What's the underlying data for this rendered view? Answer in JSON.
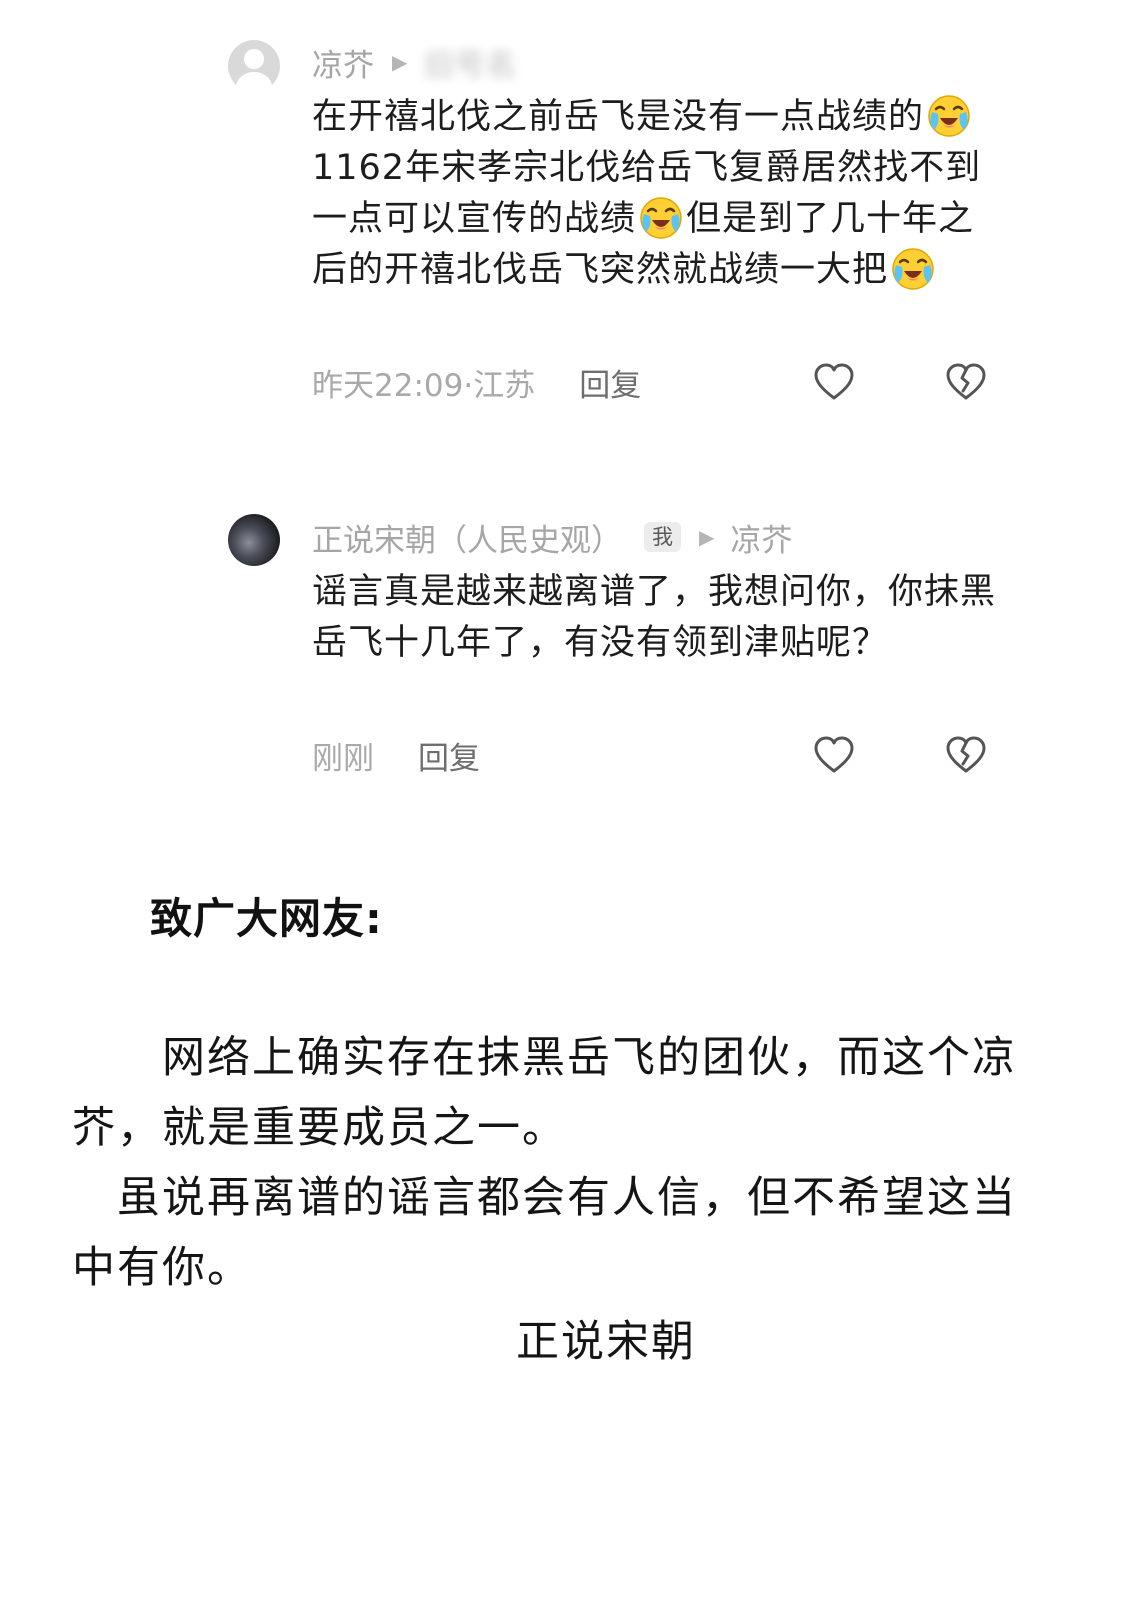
{
  "comment1": {
    "username": "凉芥",
    "reply_to": "旧号名",
    "text_segments": [
      {
        "type": "text",
        "value": "在开禧北伐之前岳飞是没有一点战绩的"
      },
      {
        "type": "emoji",
        "name": "crying-laughing-emoji"
      },
      {
        "type": "text",
        "value": "1162年宋孝宗北伐给岳飞复爵居然找不到一点可以宣传的战绩"
      },
      {
        "type": "emoji",
        "name": "crying-laughing-emoji"
      },
      {
        "type": "text",
        "value": "但是到了几十年之后的开禧北伐岳飞突然就战绩一大把"
      },
      {
        "type": "emoji",
        "name": "crying-laughing-emoji"
      }
    ],
    "timestamp": "昨天22:09·江苏",
    "reply_label": "回复",
    "like_icon": "heart-outline-icon",
    "dislike_icon": "broken-heart-icon"
  },
  "comment2": {
    "username": "正说宋朝（人民史观）",
    "badge": "我",
    "reply_to": "凉芥",
    "text": "谣言真是越来越离谱了，我想问你，你抹黑岳飞十几年了，有没有领到津贴呢？",
    "timestamp": "刚刚",
    "reply_label": "回复",
    "like_icon": "heart-outline-icon",
    "dislike_icon": "broken-heart-icon"
  },
  "notice": {
    "title": "致广大网友:",
    "paragraph1": "　　网络上确实存在抹黑岳飞的团伙，而这个凉芥，就是重要成员之一。",
    "paragraph2": "　虽说再离谱的谣言都会有人信，但不希望这当中有你。",
    "signature": "正说宋朝"
  }
}
